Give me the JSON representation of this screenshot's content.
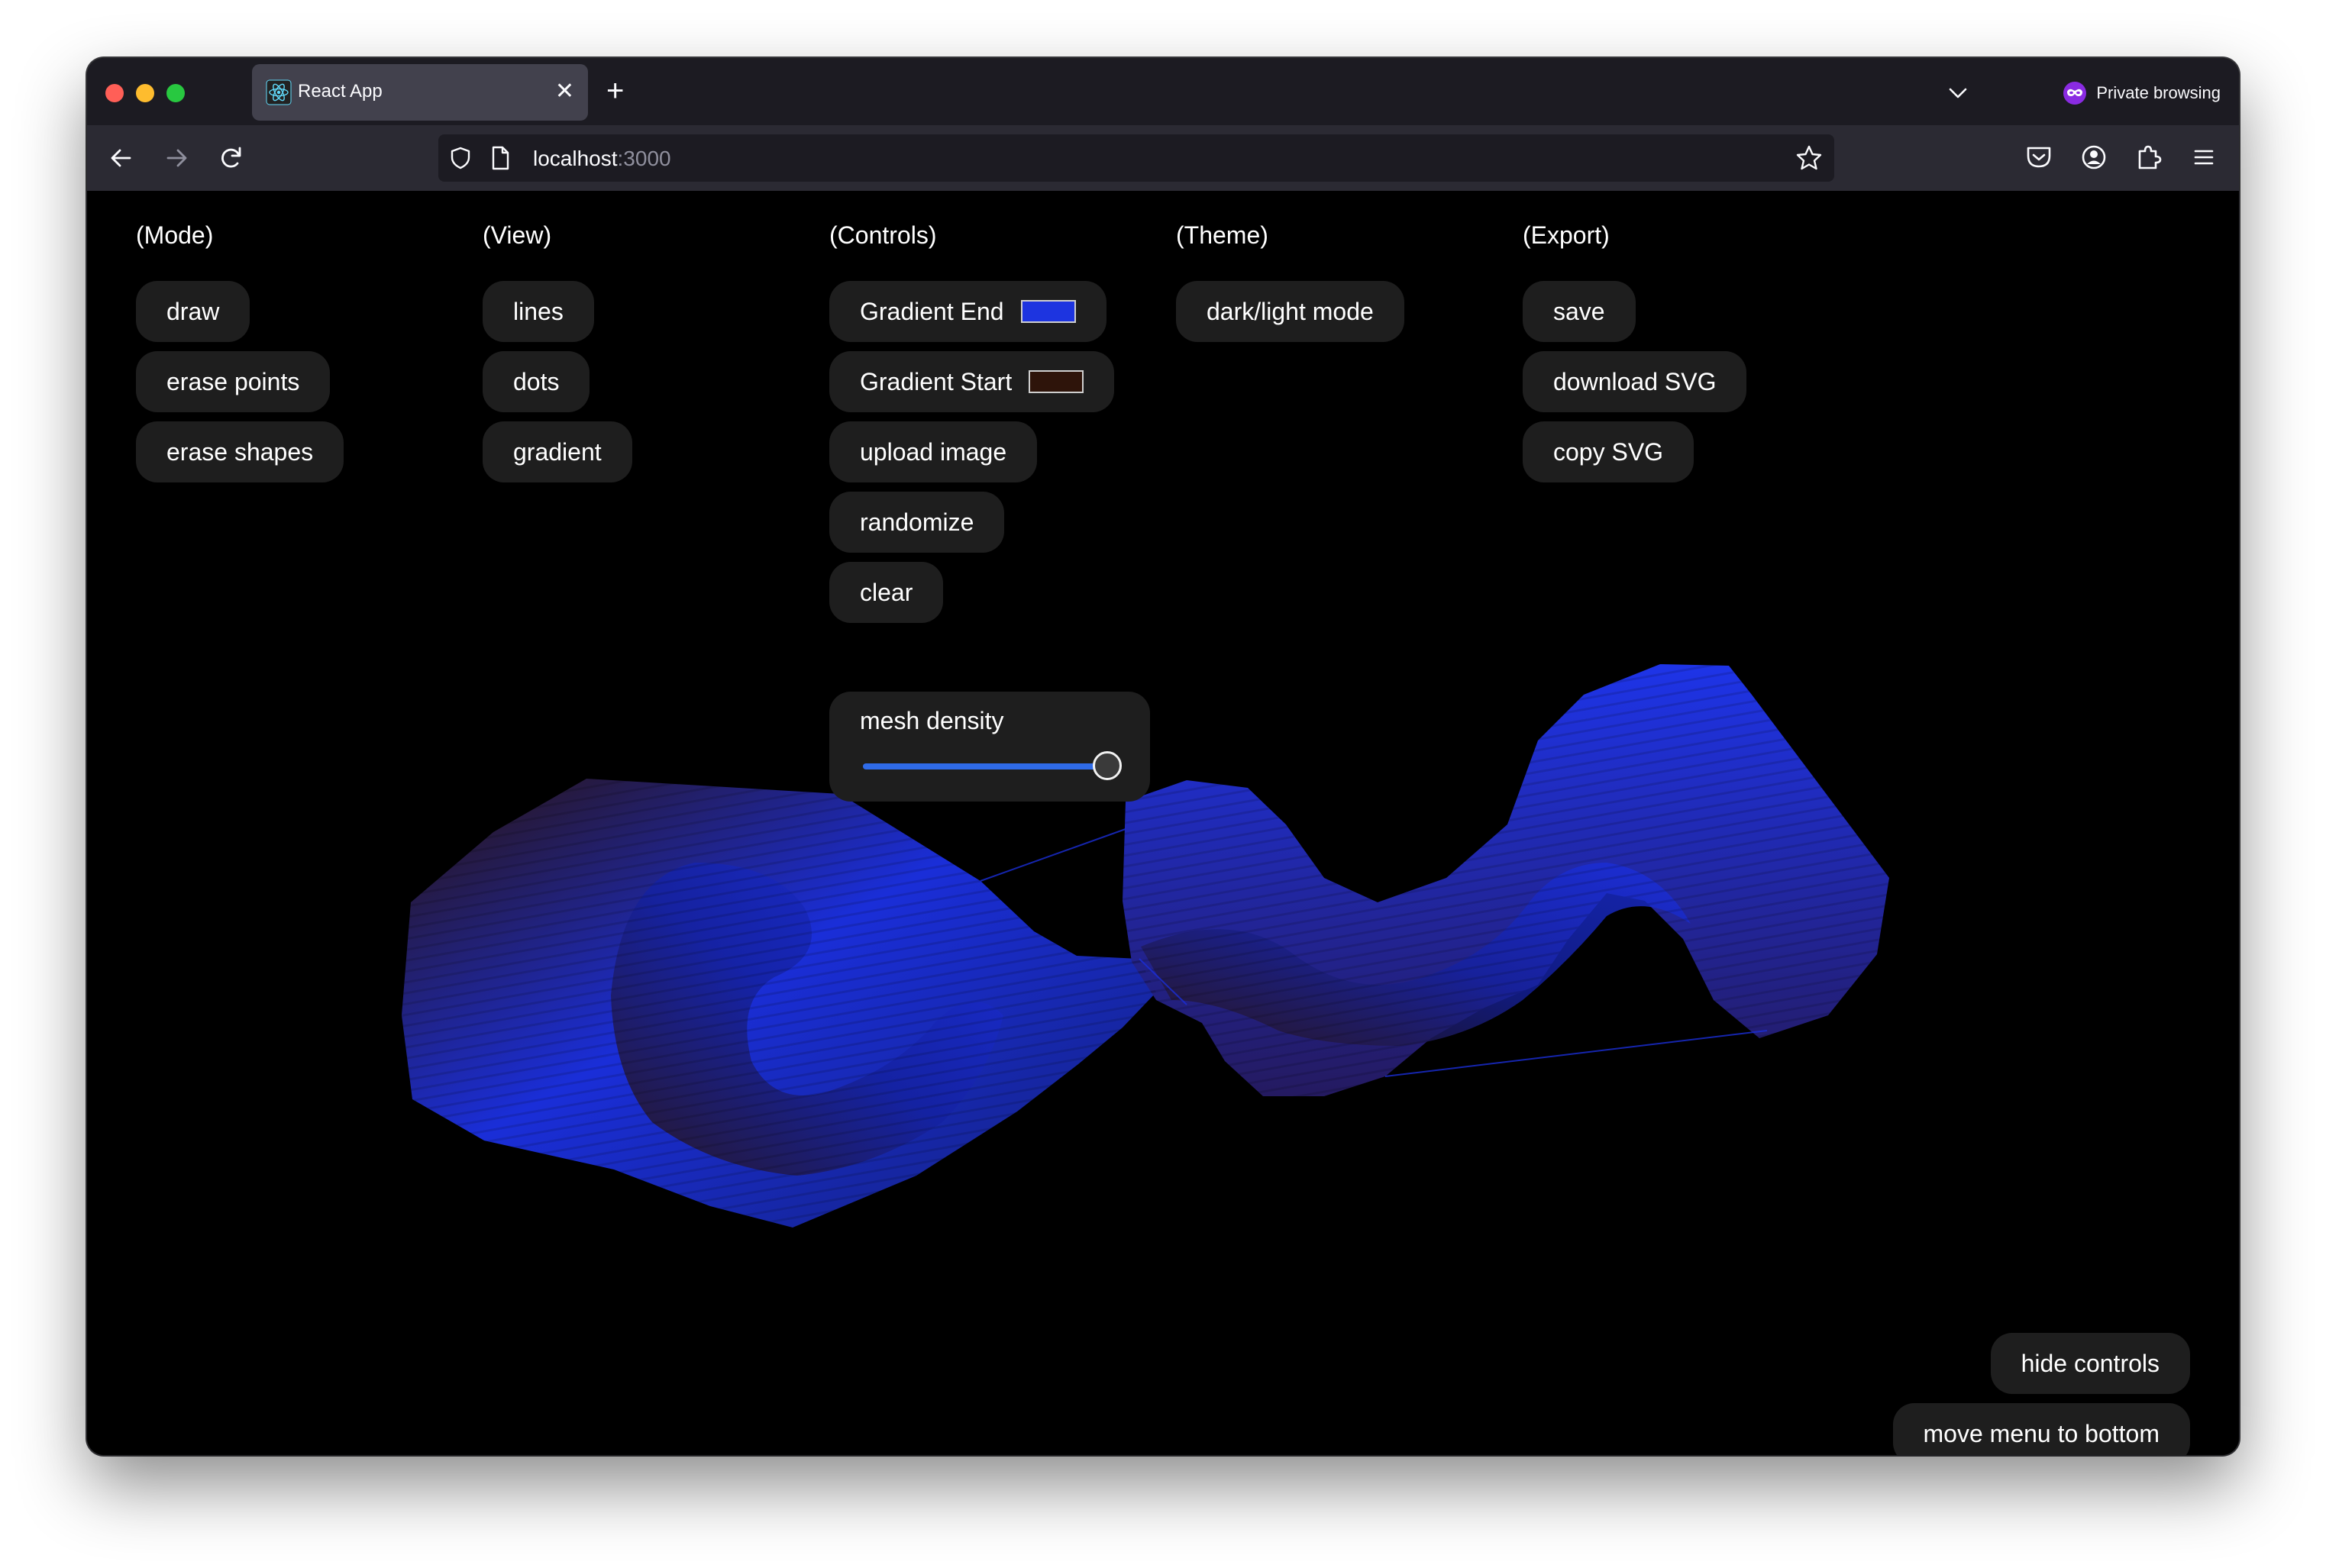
{
  "browser": {
    "tab_title": "React App",
    "url_host": "localhost",
    "url_port": ":3000",
    "private_label": "Private browsing"
  },
  "menu": {
    "mode": {
      "title": "(Mode)",
      "buttons": [
        "draw",
        "erase points",
        "erase shapes"
      ]
    },
    "view": {
      "title": "(View)",
      "buttons": [
        "lines",
        "dots",
        "gradient"
      ]
    },
    "controls": {
      "title": "(Controls)",
      "gradient_end_label": "Gradient End",
      "gradient_end_color": "#1d34e0",
      "gradient_start_label": "Gradient Start",
      "gradient_start_color": "#2e140a",
      "upload_label": "upload image",
      "randomize_label": "randomize",
      "clear_label": "clear",
      "mesh_density_label": "mesh density",
      "mesh_density_value": 1.0
    },
    "theme": {
      "title": "(Theme)",
      "buttons": [
        "dark/light mode"
      ]
    },
    "export": {
      "title": "(Export)",
      "buttons": [
        "save",
        "download SVG",
        "copy SVG"
      ]
    }
  },
  "corner_buttons": {
    "hide_controls": "hide controls",
    "move_menu": "move menu to bottom"
  },
  "colors": {
    "mesh_blue": "#1a2ed8",
    "mesh_dark": "#2a1208",
    "accent_slider": "#2f6be8"
  }
}
